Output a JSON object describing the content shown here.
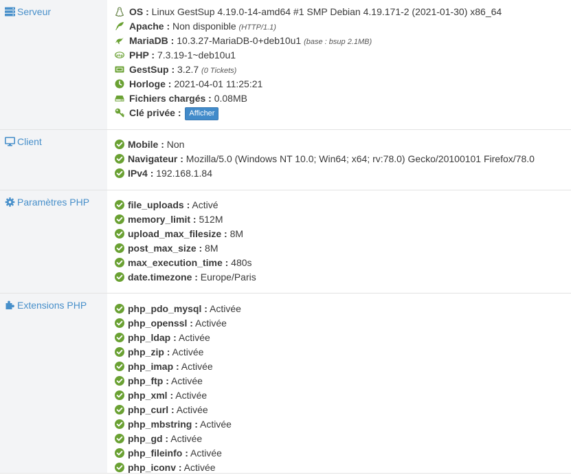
{
  "serveur": {
    "label": "Serveur",
    "rows": [
      {
        "key": "OS :",
        "value": " Linux GestSup 4.19.0-14-amd64 #1 SMP Debian 4.19.171-2 (2021-01-30) x86_64",
        "note": "",
        "icon": "linux-icon"
      },
      {
        "key": "Apache :",
        "value": " Non disponible ",
        "note": "(HTTP/1.1)",
        "icon": "feather-icon"
      },
      {
        "key": "MariaDB :",
        "value": " 10.3.27-MariaDB-0+deb10u1 ",
        "note": "(base : bsup 2.1MB)",
        "icon": "mariadb-seal-icon"
      },
      {
        "key": "PHP :",
        "value": " 7.3.19-1~deb10u1",
        "note": "",
        "icon": "php-icon"
      },
      {
        "key": "GestSup :",
        "value": " 3.2.7 ",
        "note": "(0 Tickets)",
        "icon": "ticket-icon"
      },
      {
        "key": "Horloge :",
        "value": " 2021-04-01 11:25:21",
        "note": "",
        "icon": "clock-icon"
      },
      {
        "key": "Fichiers chargés :",
        "value": " 0.08MB",
        "note": "",
        "icon": "hdd-icon"
      },
      {
        "key": "Clé privée :",
        "value": "",
        "note": "",
        "icon": "key-icon",
        "button": "Afficher"
      }
    ]
  },
  "client": {
    "label": "Client",
    "rows": [
      {
        "key": "Mobile :",
        "value": " Non"
      },
      {
        "key": "Navigateur :",
        "value": " Mozilla/5.0 (Windows NT 10.0; Win64; x64; rv:78.0) Gecko/20100101 Firefox/78.0"
      },
      {
        "key": "IPv4 :",
        "value": " 192.168.1.84"
      }
    ]
  },
  "php_params": {
    "label": "Paramètres PHP",
    "rows": [
      {
        "key": "file_uploads :",
        "value": " Activé"
      },
      {
        "key": "memory_limit :",
        "value": " 512M"
      },
      {
        "key": "upload_max_filesize :",
        "value": " 8M"
      },
      {
        "key": "post_max_size :",
        "value": " 8M"
      },
      {
        "key": "max_execution_time :",
        "value": " 480s"
      },
      {
        "key": "date.timezone :",
        "value": " Europe/Paris"
      }
    ]
  },
  "php_ext": {
    "label": "Extensions PHP",
    "rows": [
      {
        "key": "php_pdo_mysql :",
        "value": " Activée"
      },
      {
        "key": "php_openssl :",
        "value": " Activée"
      },
      {
        "key": "php_ldap :",
        "value": " Activée"
      },
      {
        "key": "php_zip :",
        "value": " Activée"
      },
      {
        "key": "php_imap :",
        "value": " Activée"
      },
      {
        "key": "php_ftp :",
        "value": " Activée"
      },
      {
        "key": "php_xml :",
        "value": " Activée"
      },
      {
        "key": "php_curl :",
        "value": " Activée"
      },
      {
        "key": "php_mbstring :",
        "value": " Activée"
      },
      {
        "key": "php_gd :",
        "value": " Activée"
      },
      {
        "key": "php_fileinfo :",
        "value": " Activée"
      },
      {
        "key": "php_iconv :",
        "value": " Activée"
      }
    ]
  },
  "colors": {
    "accent": "#478fca",
    "ok": "#6aa133",
    "label_bg": "#f3f4f6",
    "button": "#428bca"
  }
}
